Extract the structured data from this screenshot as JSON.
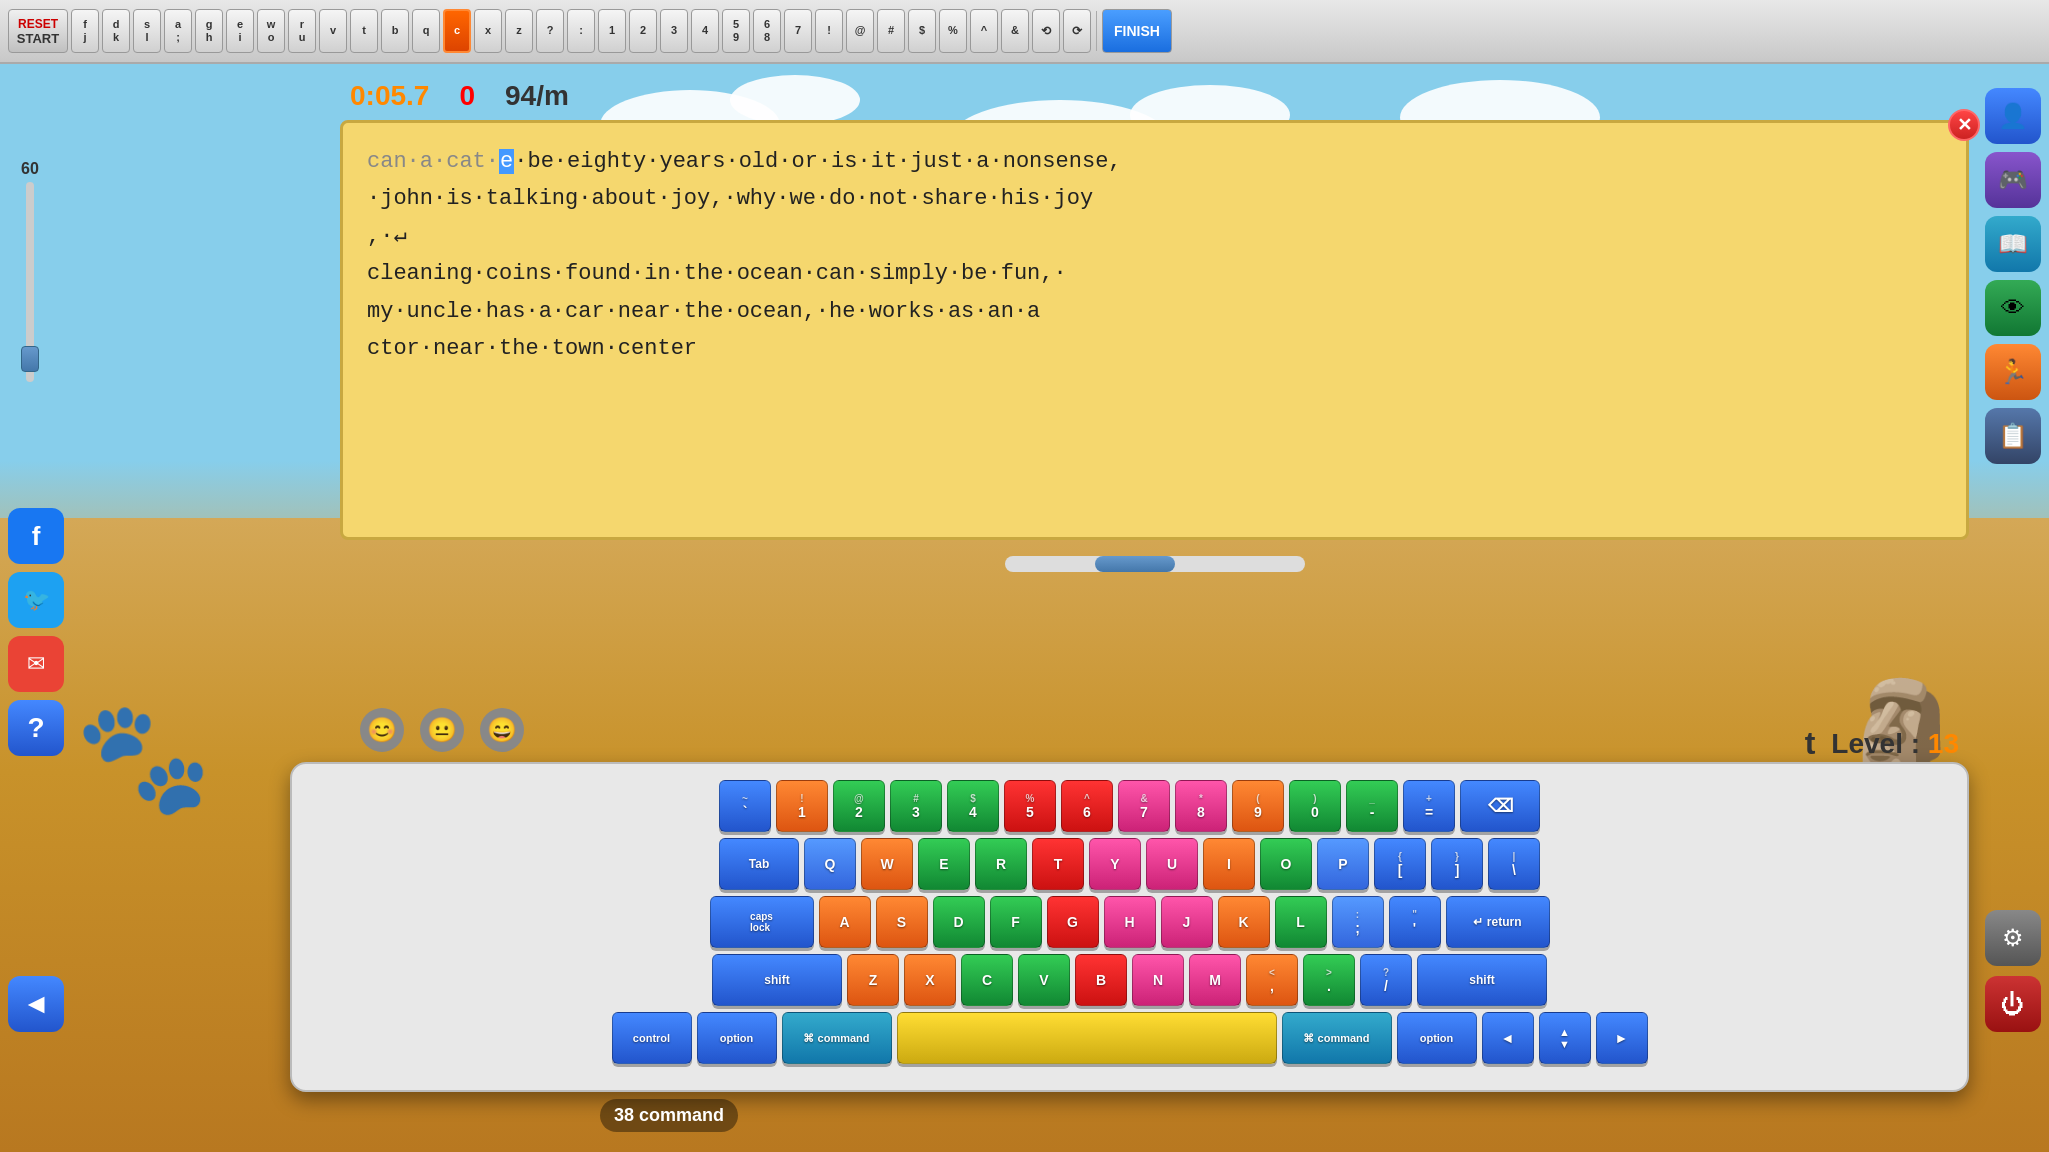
{
  "toolbar": {
    "reset_start_label": "RESET\nSTART",
    "keys": [
      {
        "top": "f",
        "bottom": "j"
      },
      {
        "top": "d",
        "bottom": "k"
      },
      {
        "top": "s",
        "bottom": "l"
      },
      {
        "top": "a",
        "bottom": ";"
      },
      {
        "top": "g",
        "bottom": "h"
      },
      {
        "top": "e",
        "bottom": "i"
      },
      {
        "top": "w",
        "bottom": "o"
      },
      {
        "top": "r",
        "bottom": "u"
      },
      {
        "top": "v",
        "bottom": ""
      },
      {
        "top": "t",
        "bottom": ""
      },
      {
        "top": "b",
        "bottom": ""
      },
      {
        "top": "q",
        "bottom": ""
      },
      {
        "top": "c",
        "bottom": "",
        "active": true
      },
      {
        "top": "x",
        "bottom": ""
      },
      {
        "top": "z",
        "bottom": ""
      },
      {
        "top": "?",
        "bottom": ""
      },
      {
        "top": ":",
        "bottom": ""
      },
      {
        "top": "1",
        "bottom": ""
      },
      {
        "top": "2",
        "bottom": ""
      },
      {
        "top": "3",
        "bottom": ""
      },
      {
        "top": "4",
        "bottom": ""
      },
      {
        "top": "5",
        "bottom": "9"
      },
      {
        "top": "6",
        "bottom": "8"
      },
      {
        "top": "7",
        "bottom": ""
      },
      {
        "top": "!",
        "bottom": ""
      },
      {
        "top": "@",
        "bottom": ""
      },
      {
        "top": "#",
        "bottom": ""
      },
      {
        "top": "$",
        "bottom": ""
      },
      {
        "top": "%",
        "bottom": ""
      },
      {
        "top": "^",
        "bottom": ""
      },
      {
        "top": "&",
        "bottom": ""
      },
      {
        "top": "⟲",
        "bottom": ""
      },
      {
        "top": "⟳",
        "bottom": ""
      },
      {
        "top": "FINISH",
        "bottom": ""
      }
    ],
    "finish_label": "FINISH"
  },
  "stats": {
    "timer": "0:05.7",
    "errors": "0",
    "wpm": "94/m"
  },
  "text_content": "can·a·cat·be·eighty·years·old·or·is·it·just·a·nonsense,·john·is·talking·about·joy,·why·we·do·not·share·his·joy,↵cleaning·coins·found·in·the·ocean·can·simply·be·fun,·my·uncle·has·a·car·near·the·ocean,·he·works·as·an·actor·near·the·town·center",
  "typed_so_far": "can·a·cat",
  "cursor_char": "e",
  "remaining_text": "·be·eighty·years·old·or·is·it·just·a·nonsense,·john·is·talking·about·joy,·why·we·do·not·share·his·joy,↵cleaning·coins·found·in·the·ocean·can·simply·be·fun,·my·uncle·has·a·car·near·the·ocean,·he·works·as·an·actor·near·the·town·center",
  "level": {
    "label": "Level : ",
    "number": "13",
    "current_char": "t"
  },
  "speed": {
    "value": "60"
  },
  "command_badge": "38 command",
  "avatars": [
    "😊",
    "😐",
    "😄"
  ],
  "keyboard": {
    "rows": [
      {
        "keys": [
          {
            "label": "~\n`",
            "color": "blue",
            "width": ""
          },
          {
            "label": "!\n1",
            "color": "orange",
            "width": ""
          },
          {
            "label": "@\n2",
            "color": "green",
            "width": ""
          },
          {
            "label": "#\n3",
            "color": "green",
            "width": ""
          },
          {
            "label": "$\n4",
            "color": "green",
            "width": ""
          },
          {
            "label": "%\n5",
            "color": "red",
            "width": ""
          },
          {
            "label": "^\n6",
            "color": "red",
            "width": ""
          },
          {
            "label": "&\n7",
            "color": "pink",
            "width": ""
          },
          {
            "label": "*\n8",
            "color": "pink",
            "width": ""
          },
          {
            "label": "(\n9",
            "color": "orange",
            "width": ""
          },
          {
            "label": ")\n0",
            "color": "green",
            "width": ""
          },
          {
            "label": "_\n-",
            "color": "green",
            "width": ""
          },
          {
            "label": "+\n=",
            "color": "blue",
            "width": ""
          },
          {
            "label": "⌫",
            "color": "blue",
            "width": "wide-15"
          }
        ]
      },
      {
        "keys": [
          {
            "label": "Tab",
            "color": "blue",
            "width": "wide-15"
          },
          {
            "label": "Q",
            "color": "blue2",
            "width": ""
          },
          {
            "label": "W",
            "color": "orange",
            "width": ""
          },
          {
            "label": "E",
            "color": "green",
            "width": ""
          },
          {
            "label": "R",
            "color": "green",
            "width": ""
          },
          {
            "label": "T",
            "color": "red",
            "width": ""
          },
          {
            "label": "Y",
            "color": "pink",
            "width": ""
          },
          {
            "label": "U",
            "color": "pink",
            "width": ""
          },
          {
            "label": "I",
            "color": "orange",
            "width": ""
          },
          {
            "label": "O",
            "color": "green",
            "width": ""
          },
          {
            "label": "P",
            "color": "blue2",
            "width": ""
          },
          {
            "label": "{\n[",
            "color": "blue",
            "width": ""
          },
          {
            "label": "}\n]",
            "color": "blue",
            "width": ""
          },
          {
            "label": "|\n\\",
            "color": "blue",
            "width": ""
          }
        ]
      },
      {
        "keys": [
          {
            "label": "caps\nlock",
            "color": "blue",
            "width": "wide-2"
          },
          {
            "label": "A",
            "color": "orange",
            "width": ""
          },
          {
            "label": "S",
            "color": "orange",
            "width": ""
          },
          {
            "label": "D",
            "color": "green",
            "width": ""
          },
          {
            "label": "F",
            "color": "green",
            "width": ""
          },
          {
            "label": "G",
            "color": "red",
            "width": ""
          },
          {
            "label": "H",
            "color": "pink",
            "width": ""
          },
          {
            "label": "J",
            "color": "pink",
            "width": ""
          },
          {
            "label": "K",
            "color": "orange",
            "width": ""
          },
          {
            "label": "L",
            "color": "green",
            "width": ""
          },
          {
            "label": ":\n;",
            "color": "blue2",
            "width": ""
          },
          {
            "label": "\"\n'",
            "color": "blue",
            "width": ""
          },
          {
            "label": "↵\nreturn",
            "color": "blue",
            "width": "wide-2"
          }
        ]
      },
      {
        "keys": [
          {
            "label": "shift",
            "color": "blue",
            "width": "wide-25"
          },
          {
            "label": "Z",
            "color": "orange",
            "width": ""
          },
          {
            "label": "X",
            "color": "orange",
            "width": ""
          },
          {
            "label": "C",
            "color": "green",
            "width": ""
          },
          {
            "label": "V",
            "color": "green",
            "width": ""
          },
          {
            "label": "B",
            "color": "red",
            "width": ""
          },
          {
            "label": "N",
            "color": "pink",
            "width": ""
          },
          {
            "label": "M",
            "color": "pink",
            "width": ""
          },
          {
            "label": "<\n,",
            "color": "orange",
            "width": ""
          },
          {
            "label": ">\n.",
            "color": "green",
            "width": ""
          },
          {
            "label": "?\n/",
            "color": "blue",
            "width": ""
          },
          {
            "label": "shift",
            "color": "blue",
            "width": "wide-25"
          }
        ]
      },
      {
        "keys": [
          {
            "label": "control",
            "color": "blue",
            "width": "wide-15"
          },
          {
            "label": "option",
            "color": "blue",
            "width": "wide-15"
          },
          {
            "label": "⌘\ncommand",
            "color": "teal",
            "width": "wide-cmd"
          },
          {
            "label": "",
            "color": "yellow",
            "width": "wide-space"
          },
          {
            "label": "⌘\ncommand",
            "color": "teal",
            "width": "wide-cmd"
          },
          {
            "label": "option",
            "color": "blue",
            "width": "wide-15"
          },
          {
            "label": "◄",
            "color": "blue",
            "width": ""
          },
          {
            "label": "▲\n▼",
            "color": "blue",
            "width": ""
          },
          {
            "label": "►",
            "color": "blue",
            "width": ""
          }
        ]
      }
    ]
  },
  "right_buttons": [
    {
      "icon": "👤",
      "color": "blue",
      "name": "profile-button"
    },
    {
      "icon": "🎮",
      "color": "purple",
      "name": "game-button"
    },
    {
      "icon": "📖",
      "color": "teal",
      "name": "lessons-button"
    },
    {
      "icon": "👁",
      "color": "green",
      "name": "view-button"
    },
    {
      "icon": "🏃",
      "color": "orange",
      "name": "run-button"
    },
    {
      "icon": "📋",
      "color": "gray-blue",
      "name": "clipboard-button"
    }
  ],
  "social_buttons": [
    {
      "icon": "f",
      "color": "fb-btn",
      "name": "facebook-button"
    },
    {
      "icon": "🐦",
      "color": "tw-btn",
      "name": "twitter-button"
    },
    {
      "icon": "✉",
      "color": "mail-btn",
      "name": "mail-button"
    },
    {
      "icon": "?",
      "color": "help-btn",
      "name": "help-button"
    }
  ]
}
